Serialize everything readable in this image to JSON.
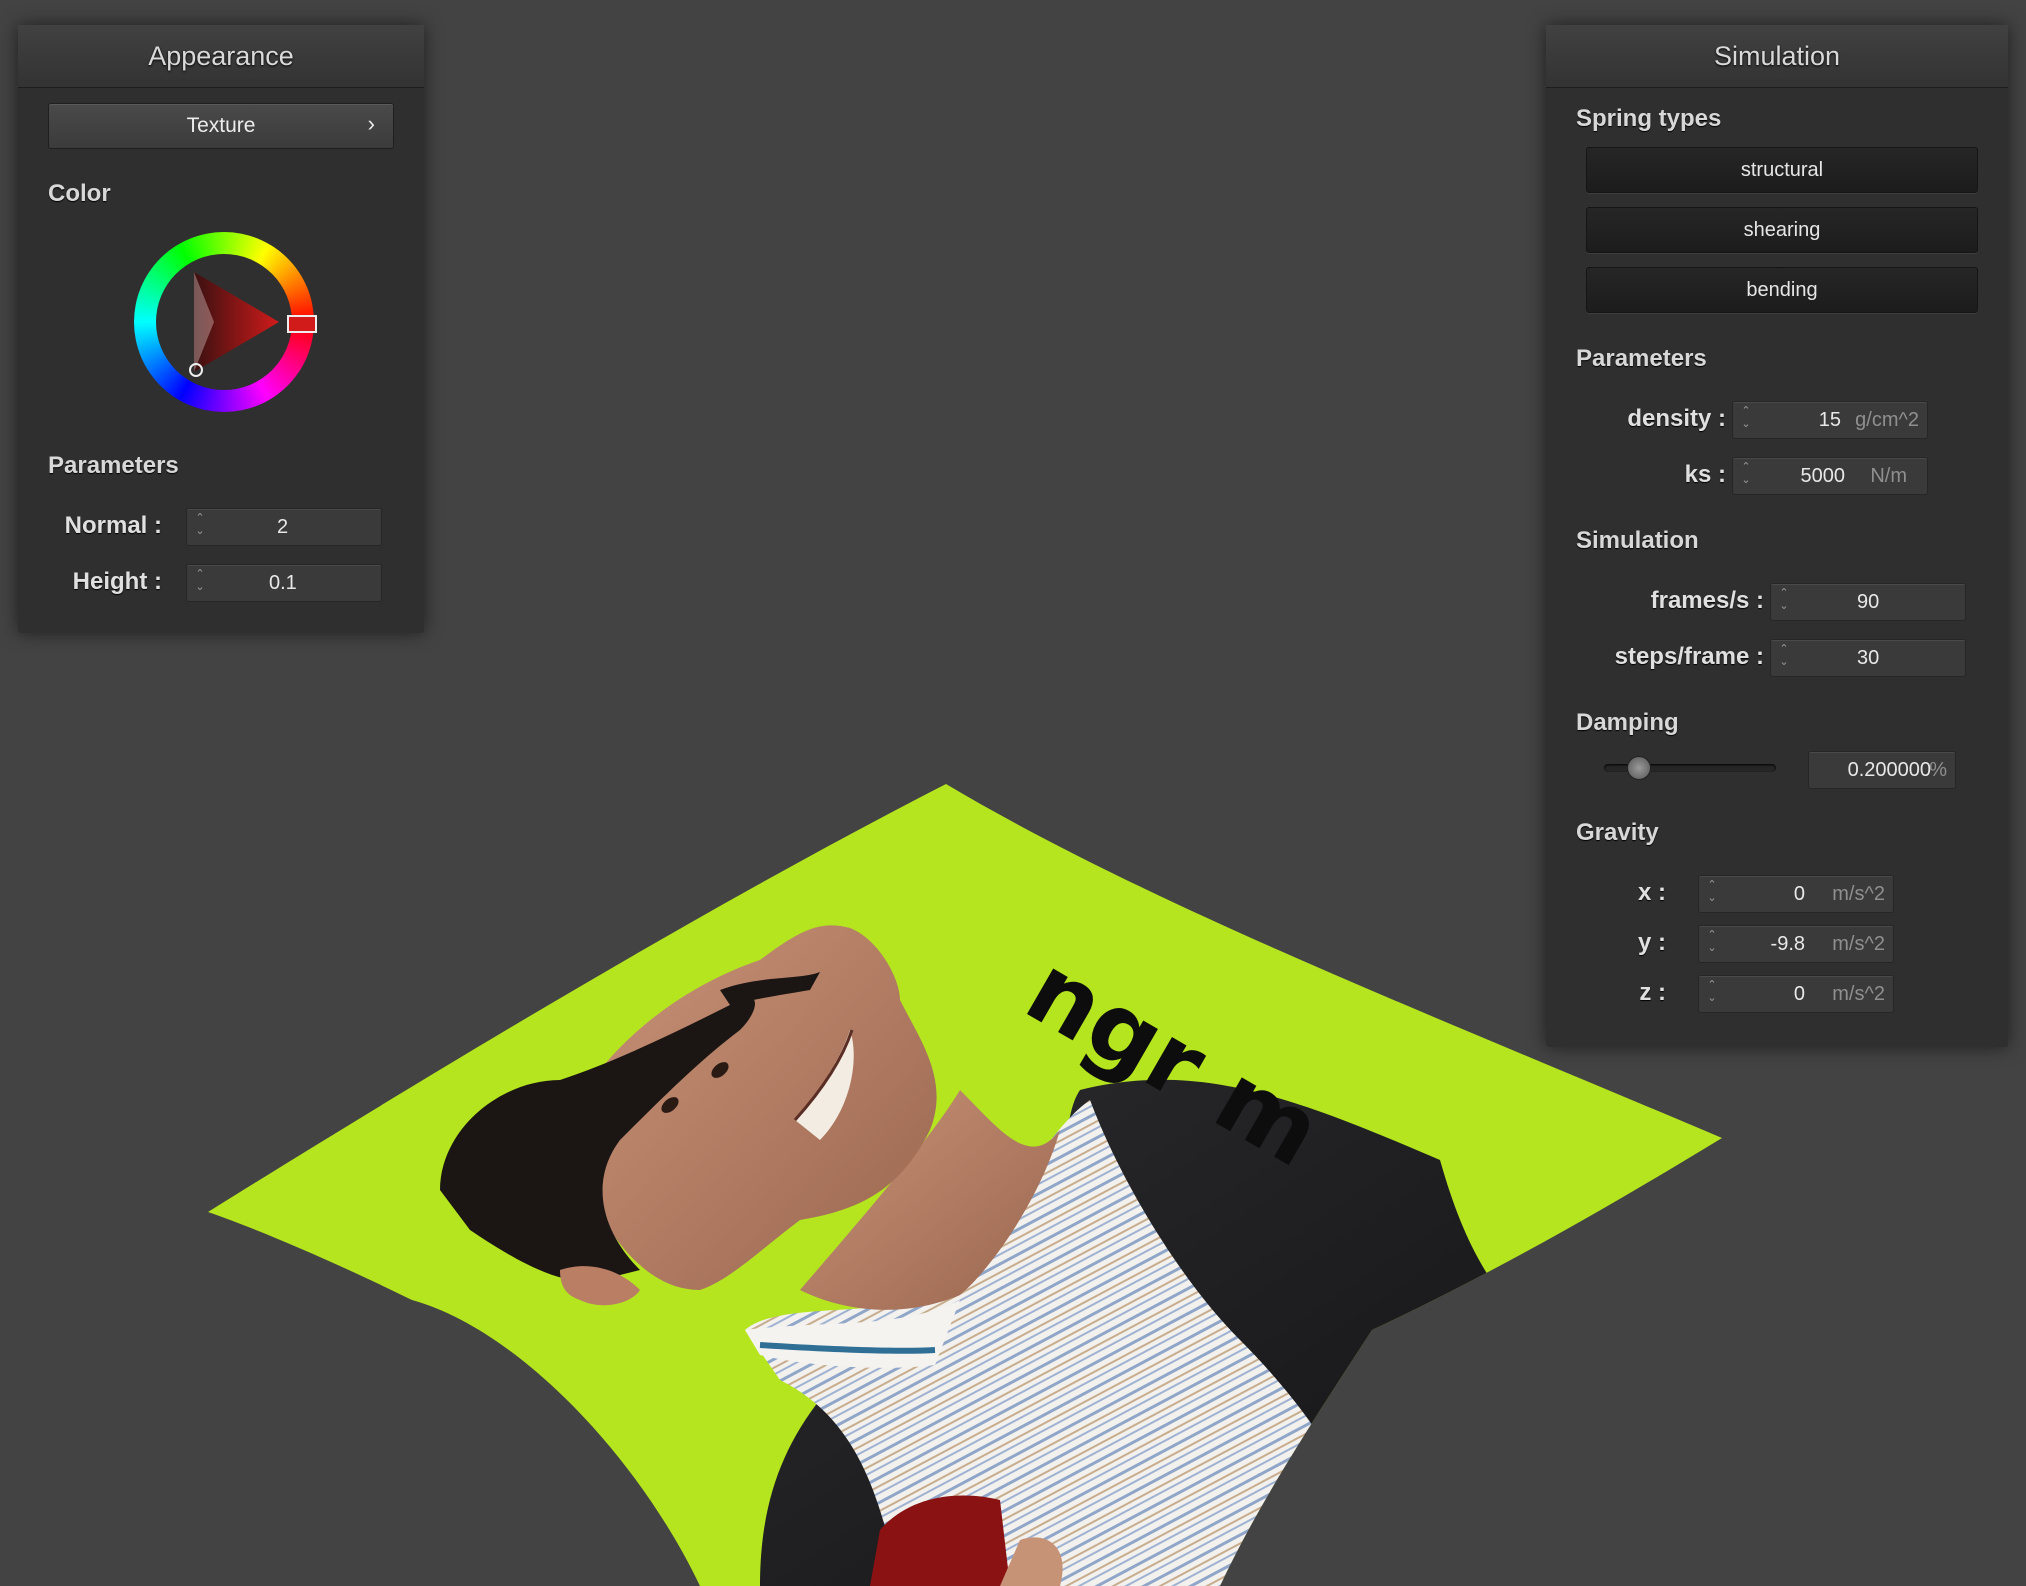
{
  "appearance": {
    "title": "Appearance",
    "texture_button": "Texture",
    "texture_chevron": "›",
    "color_section": "Color",
    "parameters_section": "Parameters",
    "normal_label": "Normal :",
    "normal_value": "2",
    "height_label": "Height :",
    "height_value": "0.1",
    "selected_color": "#d11b1b"
  },
  "simulation": {
    "title": "Simulation",
    "spring_types_section": "Spring types",
    "spring_types": [
      "structural",
      "shearing",
      "bending"
    ],
    "parameters_section": "Parameters",
    "density_label": "density :",
    "density_value": "15",
    "density_unit": "g/cm^2",
    "ks_label": "ks :",
    "ks_value": "5000",
    "ks_unit": "N/m",
    "simulation_section": "Simulation",
    "fps_label": "frames/s :",
    "fps_value": "90",
    "steps_label": "steps/frame :",
    "steps_value": "30",
    "damping_section": "Damping",
    "damping_value": "0.200000",
    "damping_unit": "%",
    "damping_fraction": 0.2,
    "gravity_section": "Gravity",
    "gx_label": "x :",
    "gx_value": "0",
    "gy_label": "y :",
    "gy_value": "-9.8",
    "gz_label": "z :",
    "gz_value": "0",
    "gravity_unit": "m/s^2"
  },
  "cloth": {
    "texture_text": "ngr m",
    "background_color": "#b4e51e"
  }
}
